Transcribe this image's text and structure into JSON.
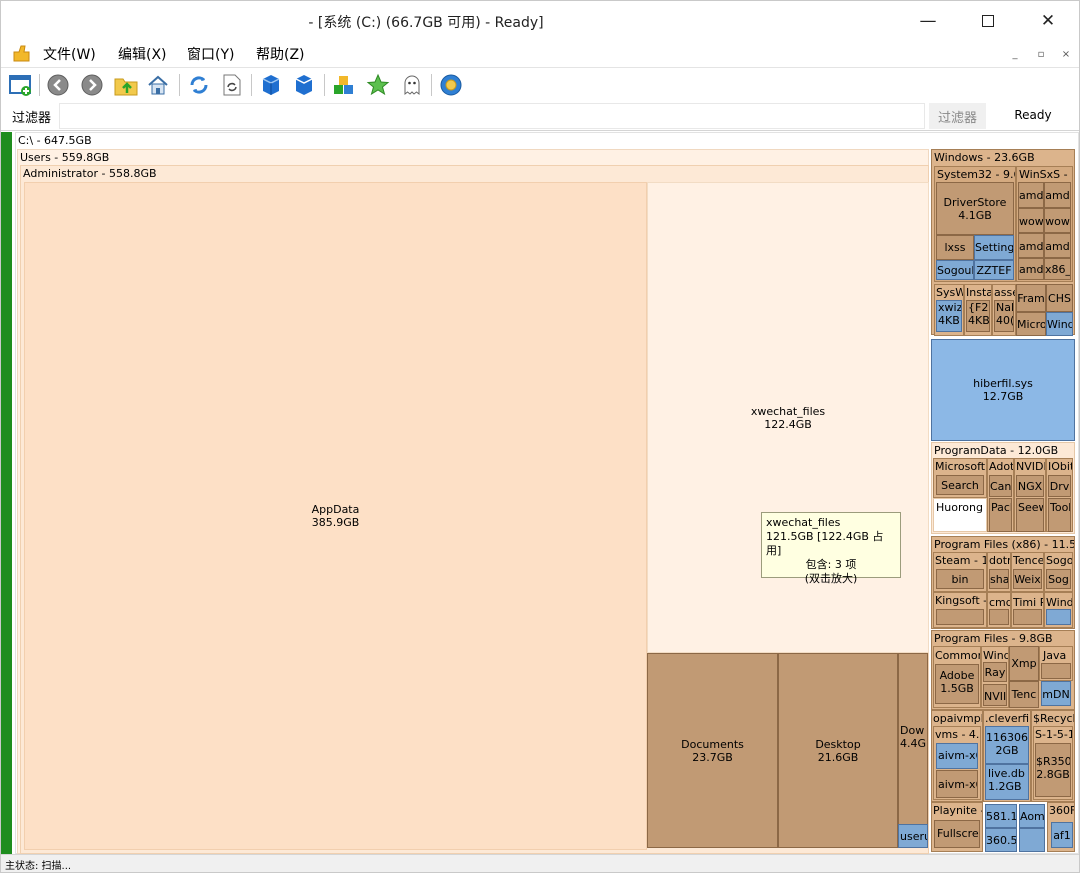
{
  "window": {
    "title": "- [系统 (C:) (66.7GB 可用) - Ready]"
  },
  "menu": {
    "file": "文件(W)",
    "edit": "编辑(X)",
    "window": "窗口(Y)",
    "help": "帮助(Z)"
  },
  "filter": {
    "label": "过滤器",
    "button": "过滤器",
    "status": "Ready"
  },
  "tree": {
    "root": "C:\\ - 647.5GB",
    "users": "Users - 559.8GB",
    "admin": "Administrator - 558.8GB",
    "appdata": {
      "name": "AppData",
      "size": "385.9GB"
    },
    "xwechat": {
      "name": "xwechat_files",
      "size": "122.4GB"
    },
    "documents": {
      "name": "Documents",
      "size": "23.7GB"
    },
    "desktop": {
      "name": "Desktop",
      "size": "21.6GB"
    },
    "downloads": {
      "name": "Dow",
      "size": "4.4G"
    },
    "useru": "useru"
  },
  "right": {
    "windows": "Windows - 23.6GB",
    "system32": "System32 - 9.6",
    "winsxs": "WinSxS - (",
    "driverstore": {
      "name": "DriverStore",
      "size": "4.1GB"
    },
    "lxss": "lxss",
    "setting": "Setting",
    "sogou": "SogouI",
    "zztef": "ZZTEF",
    "amd": "amd",
    "wow": "wow",
    "x86": "x86_",
    "sysw": "SysW",
    "insta": "Insta",
    "asse": "asse",
    "fram": "Fram",
    "chs": "CHS",
    "xwiz": "xwiz",
    "fourkb": "4KB",
    "f25": "{F25",
    "nal": "Nal",
    "n40": "40(",
    "micro": "Micro",
    "wind": "Wind",
    "hiberfil": {
      "name": "hiberfil.sys",
      "size": "12.7GB"
    },
    "programdata": "ProgramData - 12.0GB",
    "microsoft": "Microsoft",
    "adot": "Adot",
    "nvid": "NVIDI",
    "iobit": "IObit",
    "search": "Search",
    "can": "Can",
    "ngx": "NGX",
    "drv": "Drv",
    "huorong": "Huorong",
    "pack": "Pack",
    "seew": "Seew",
    "tool": "Tooll",
    "pfx86": "Program Files (x86) - 11.5G",
    "steam": "Steam - 1",
    "dotr": "dotr",
    "tence": "Tence",
    "sogo": "Sogo",
    "bin": "bin",
    "sha": "sha",
    "weix": "Weix",
    "sog": "Sog",
    "kingsoft": "Kingsoft -",
    "cmd": "cmd",
    "timi": "Timi P",
    "windx": "Wind",
    "pf": "Program Files - 9.8GB",
    "common": "Commor",
    "windp": "Wind",
    "xmp": "Xmp",
    "java": "Java",
    "ray": "Ray",
    "adobe": {
      "name": "Adobe",
      "size": "1.5GB"
    },
    "nvii": "NVII",
    "tenc": "Tenc",
    "mdn": "mDN",
    "opai": "opaivmpk",
    "cleverfil": ".cleverfik",
    "recycle": "$Recycl",
    "vms": "vms - 4.",
    "n116": "116306",
    "n116s": "2GB",
    "s151": "S-1-5-1",
    "aivm1": "aivm-x6",
    "aivm2": "aivm-x6",
    "live": "live.db",
    "lives": "1.2GB",
    "r350": "$R350",
    "r350s": "2.8GB",
    "playnite": "Playnite -",
    "n581": "581.1",
    "aom": "Aom",
    "n360f": "360F",
    "fullscr": "Fullscre",
    "n360": "360.5",
    "af1": "af1"
  },
  "tooltip": {
    "name": "xwechat_files",
    "size": "121.5GB [122.4GB 占用]",
    "contains": "包含: 3 项",
    "hint": "(双击放大)"
  },
  "status": "主状态: 扫描..."
}
